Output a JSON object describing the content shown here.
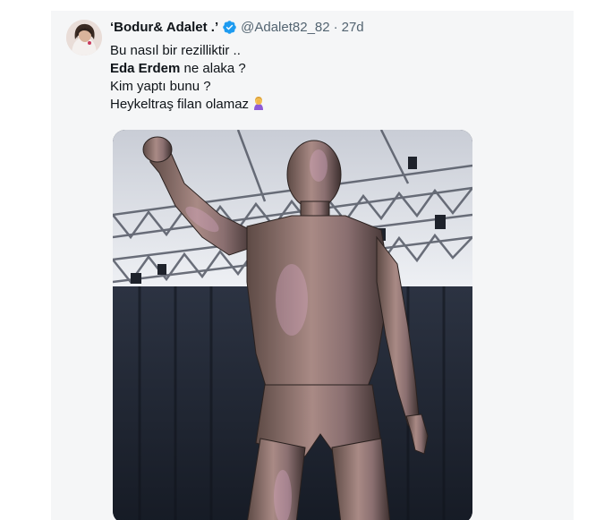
{
  "tweet": {
    "author": {
      "display_name": "‘Bodur& Adalet .’",
      "handle": "@Adalet82_82",
      "verified": true
    },
    "separator": "·",
    "timestamp": "27d",
    "lines": [
      {
        "text": "Bu nasıl bir rezillik"
      },
      {
        "prefix": "",
        "mention": "Eda Erdem",
        "suffix": " ne alaka ?"
      },
      {
        "text": "Kim yaptı bunu ?"
      },
      {
        "text": "Heykeltraş filan olamaz",
        "emoji": "woman-facepalming-icon"
      }
    ],
    "line1_suffix": "tir ..",
    "media": {
      "description_icon": "statue-photo"
    },
    "colors": {
      "background": "#f5f6f7",
      "verified_badge": "#1d9bf0",
      "secondary_text": "#536471",
      "primary_text": "#0f1419"
    }
  }
}
